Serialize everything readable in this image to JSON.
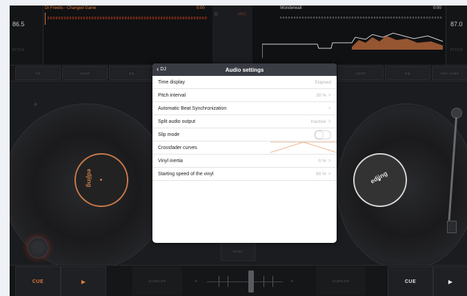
{
  "deck_left": {
    "bpm": "86.5",
    "pitch_label": "PITCH",
    "track_title": "Dr Freebs - Changed Game",
    "track_time": "0:00",
    "rec_label": "+REC",
    "fx": "FX",
    "loop": "LOOP",
    "eq": "EQ",
    "label_text": "edjing",
    "cue": "CUE",
    "play": "▶",
    "sampler": "SAMPLER"
  },
  "deck_right": {
    "bpm": "87.0",
    "pitch_label": "PITCH",
    "track_title": "Wonderwall",
    "track_time": "0:00",
    "loop": "LOOP",
    "eq": "EQ",
    "hot_cues": "HOT CUES",
    "label_text": "edjing",
    "cue": "CUE",
    "play": "▶",
    "sampler": "SAMPLER"
  },
  "center": {
    "sync": "SYNC"
  },
  "dialog": {
    "back_label": "DJ",
    "title": "Audio settings",
    "rows": [
      {
        "label": "Time display",
        "value": "Elapsed",
        "chevron": ""
      },
      {
        "label": "Pitch interval",
        "value": "30 %",
        "chevron": ">"
      },
      {
        "label": "Automatic Beat Synchronization",
        "value": "",
        "chevron": ">"
      },
      {
        "label": "Split audio output",
        "value": "Inactive",
        "chevron": ">"
      },
      {
        "label": "Slip mode",
        "value": "",
        "chevron": ""
      },
      {
        "label": "Crossfader curves",
        "value": "",
        "chevron": ""
      },
      {
        "label": "Vinyl inertia",
        "value": "0 %",
        "chevron": ">"
      },
      {
        "label": "Starting speed of the vinyl",
        "value": "80 %",
        "chevron": ">"
      }
    ],
    "slip_mode_on": false
  },
  "colors": {
    "accent": "#e07a3a",
    "dialog_header": "#3a3c44",
    "background": "#1b1c1f"
  }
}
